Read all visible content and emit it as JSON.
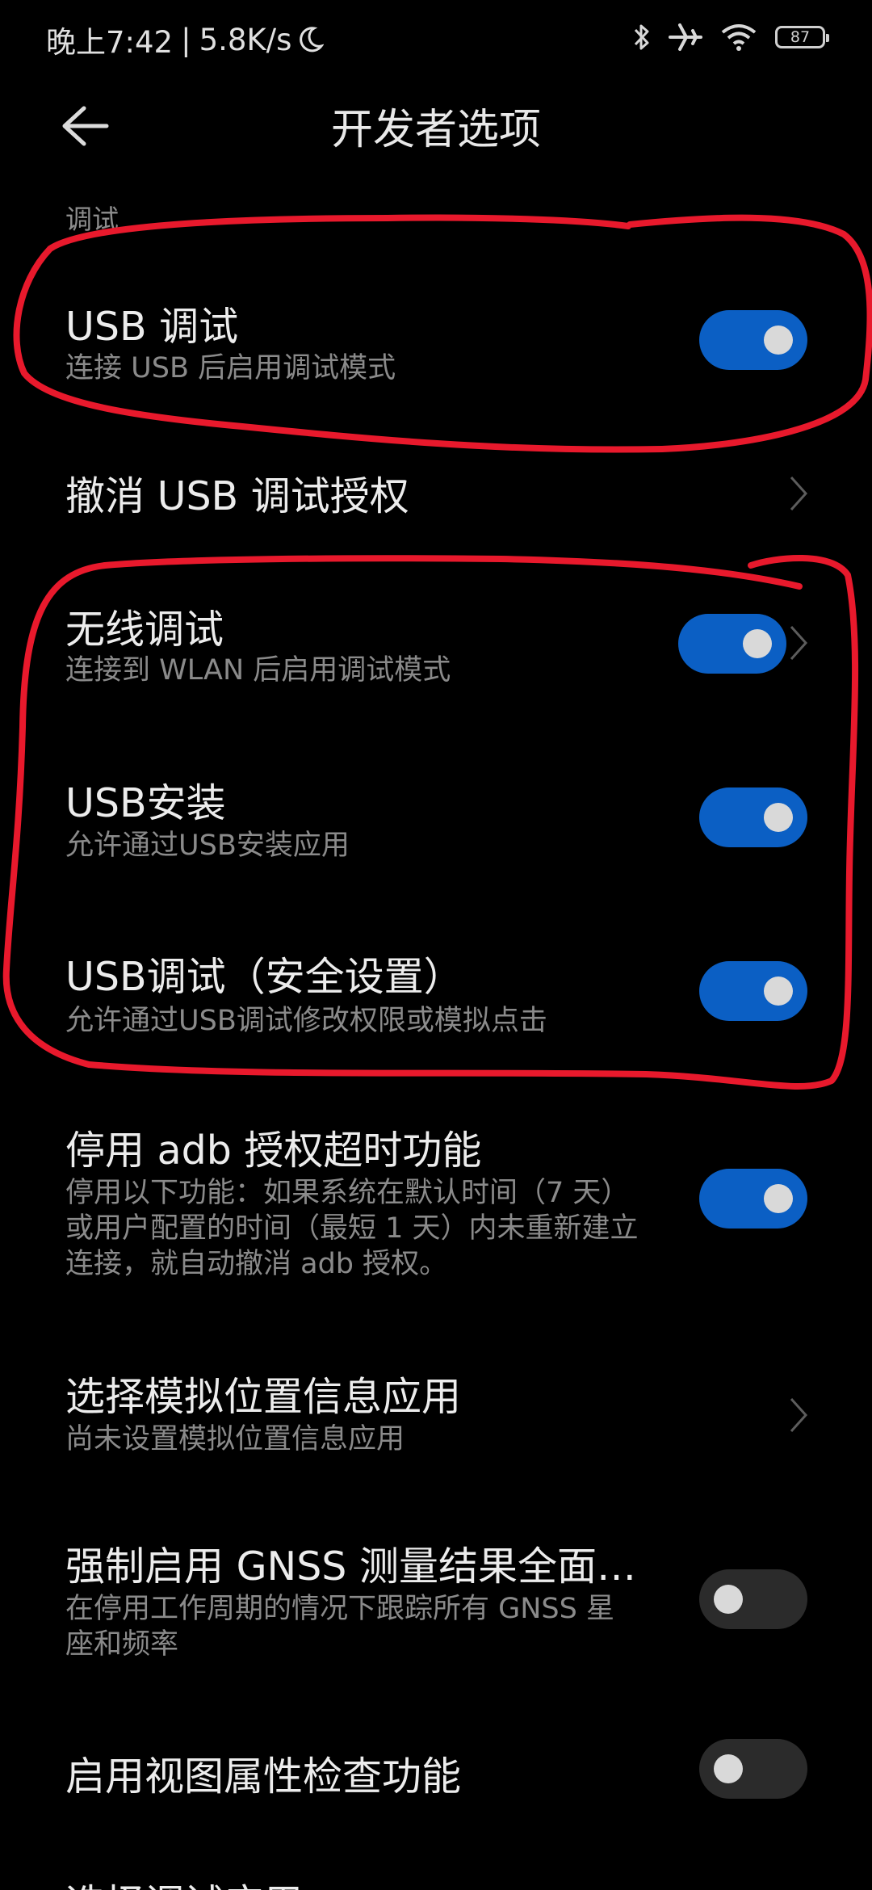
{
  "status_bar": {
    "time": "晚上7:42",
    "separator": "|",
    "speed": "5.8K/s",
    "battery": "87",
    "icons": [
      "moon-icon",
      "bluetooth-icon",
      "airplane-icon",
      "wifi-icon",
      "battery-icon"
    ]
  },
  "header": {
    "title": "开发者选项",
    "back_icon": "back-arrow-icon"
  },
  "section": {
    "label": "调试"
  },
  "items": [
    {
      "title": "USB 调试",
      "subtitle": "连接 USB 后启用调试模式",
      "control": "toggle",
      "on": true
    },
    {
      "title": "撤消 USB 调试授权",
      "control": "chevron"
    },
    {
      "title": "无线调试",
      "subtitle": "连接到 WLAN 后启用调试模式",
      "control": "toggle+chevron",
      "on": true
    },
    {
      "title": "USB安装",
      "subtitle": "允许通过USB安装应用",
      "control": "toggle",
      "on": true
    },
    {
      "title": "USB调试（安全设置）",
      "subtitle": "允许通过USB调试修改权限或模拟点击",
      "control": "toggle",
      "on": true
    },
    {
      "title": "停用 adb 授权超时功能",
      "subtitle_lines": [
        "停用以下功能：如果系统在默认时间（7 天）",
        "或用户配置的时间（最短 1 天）内未重新建立",
        "连接，就自动撤消 adb 授权。"
      ],
      "control": "toggle",
      "on": true
    },
    {
      "title": "选择模拟位置信息应用",
      "subtitle": "尚未设置模拟位置信息应用",
      "control": "chevron"
    },
    {
      "title": "强制启用 GNSS 测量结果全面…",
      "subtitle_lines": [
        "在停用工作周期的情况下跟踪所有 GNSS 星",
        "座和频率"
      ],
      "control": "toggle",
      "on": false
    },
    {
      "title": "启用视图属性检查功能",
      "control": "toggle",
      "on": false
    },
    {
      "title": "选择调试应用",
      "control": "none"
    }
  ],
  "colors": {
    "background": "#000000",
    "toggle_on": "#0b5fc4",
    "toggle_off": "#2b2b2b",
    "annotation": "#e8192c"
  }
}
